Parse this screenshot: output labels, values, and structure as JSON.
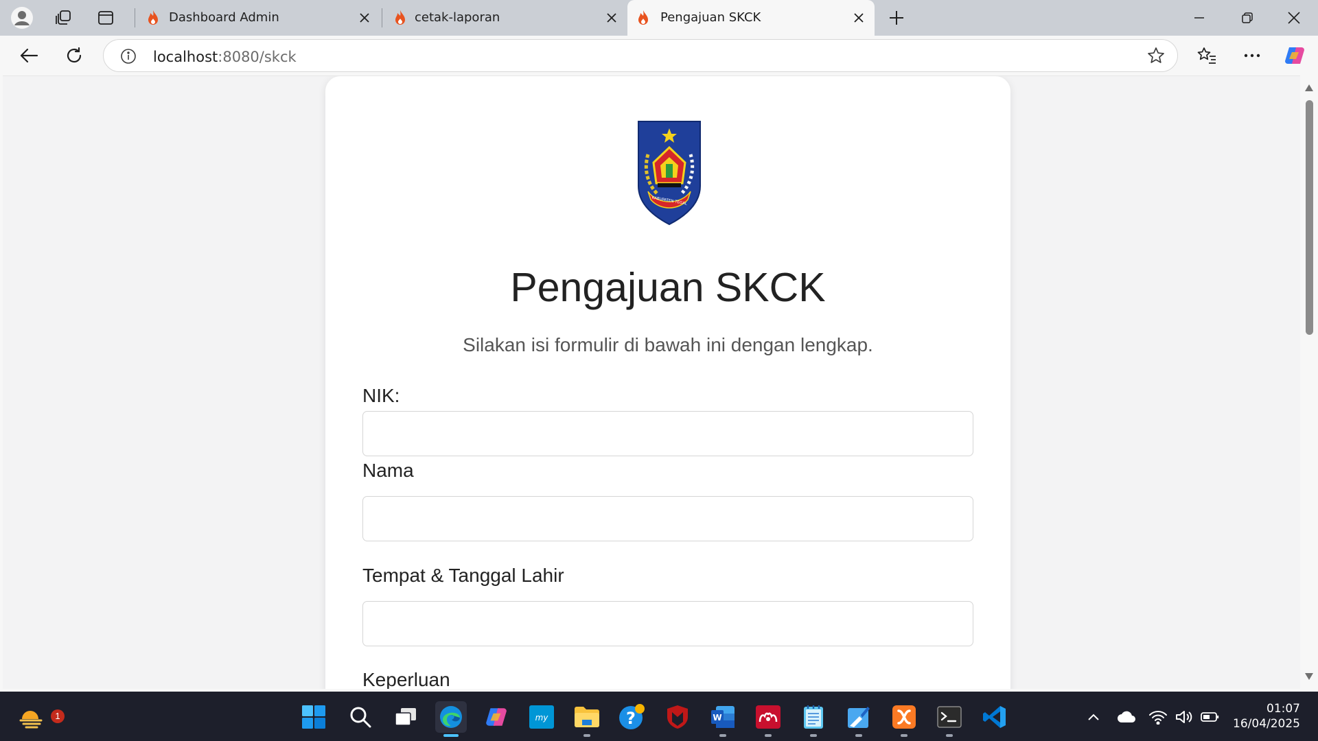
{
  "browser": {
    "tabs": [
      {
        "title": "Dashboard Admin",
        "active": false
      },
      {
        "title": "cetak-laporan",
        "active": false
      },
      {
        "title": "Pengajuan SKCK",
        "active": true
      }
    ],
    "address": {
      "host": "localhost",
      "path": ":8080/skck"
    }
  },
  "page": {
    "title": "Pengajuan SKCK",
    "subtitle": "Silakan isi formulir di bawah ini dengan lengkap.",
    "logo_text": "KABUPATEN TEGAL",
    "fields": [
      {
        "label": "NIK:",
        "value": ""
      },
      {
        "label": "Nama",
        "value": ""
      },
      {
        "label": "Tempat & Tanggal Lahir",
        "value": ""
      },
      {
        "label": "Keperluan",
        "value": ""
      }
    ]
  },
  "taskbar": {
    "widget_badge": "1",
    "clock": {
      "time": "01:07",
      "date": "16/04/2025"
    }
  },
  "colors": {
    "accent": "#4cc2ff",
    "tabbar": "#cbcfd5",
    "favicon": "#e8531f",
    "taskbar": "#1d1f2b"
  }
}
